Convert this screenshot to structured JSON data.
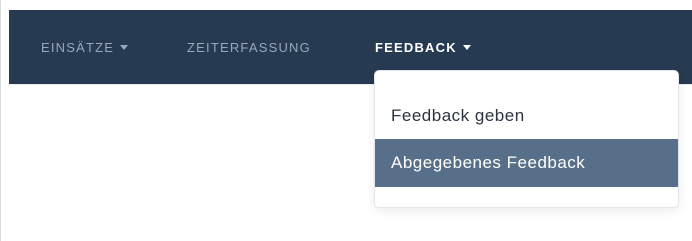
{
  "topbar": {
    "background": "#263a52",
    "items": [
      {
        "label": "EINSÄTZE",
        "has_caret": true,
        "active": false
      },
      {
        "label": "ZEITERFASSUNG",
        "has_caret": false,
        "active": false
      },
      {
        "label": "FEEDBACK",
        "has_caret": true,
        "active": true
      }
    ]
  },
  "dropdown": {
    "items": [
      {
        "label": "Feedback geben",
        "selected": false
      },
      {
        "label": "Abgegebenes Feedback",
        "selected": true
      }
    ],
    "selected_background": "#576f88"
  },
  "icons": {
    "caret": "caret-down-icon"
  }
}
